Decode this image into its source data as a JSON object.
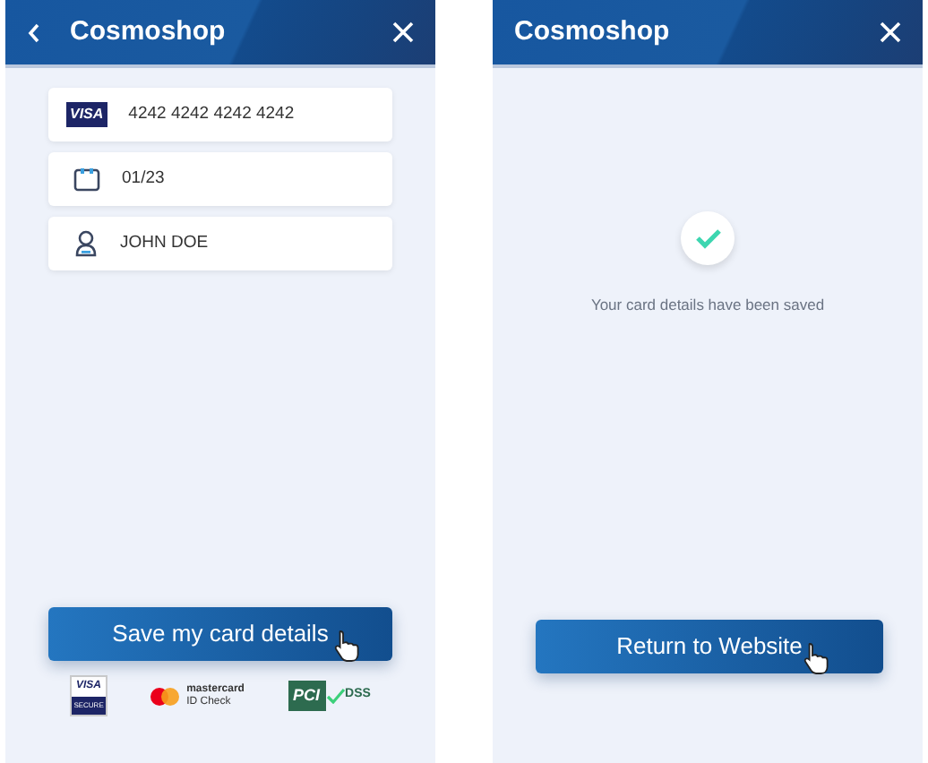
{
  "screens": [
    {
      "title": "Cosmoshop",
      "back": true,
      "fields": [
        {
          "kind": "card",
          "value": "4242 4242 4242 4242",
          "badge": "VISA"
        },
        {
          "kind": "date",
          "value": "01/23"
        },
        {
          "kind": "person",
          "value": "JOHN DOE"
        }
      ],
      "button": "Save my card details",
      "logos": [
        {
          "kind": "visa",
          "lines": [
            "VISA",
            "SECURE"
          ]
        },
        {
          "kind": "mastercard",
          "lines": [
            "mastercard",
            "ID Check"
          ]
        },
        {
          "kind": "pci",
          "lines": [
            "PCI",
            "DSS"
          ]
        }
      ]
    },
    {
      "title": "Cosmoshop",
      "back": false,
      "message": "Your card details have been saved",
      "button": "Return to Website"
    }
  ]
}
